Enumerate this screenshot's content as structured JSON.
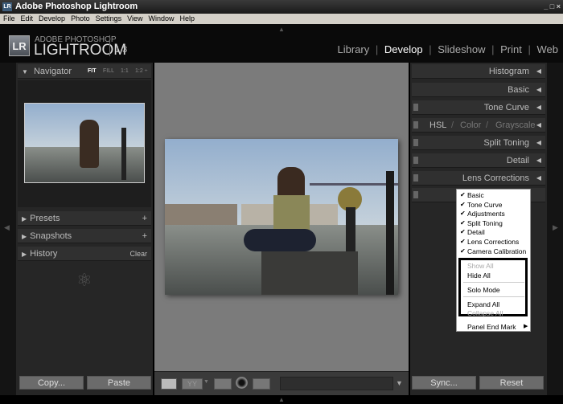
{
  "window": {
    "title": "Adobe Photoshop Lightroom",
    "app_icon": "LR",
    "controls": "_ □ ×"
  },
  "menubar": [
    "File",
    "Edit",
    "Develop",
    "Photo",
    "Settings",
    "View",
    "Window",
    "Help"
  ],
  "logo": {
    "badge": "LR",
    "line1": "ADOBE PHOTOSHOP",
    "line2": "LIGHTROOM",
    "version": "1.3"
  },
  "modules": [
    {
      "label": "Library"
    },
    {
      "label": "Develop",
      "active": true
    },
    {
      "label": "Slideshow"
    },
    {
      "label": "Print"
    },
    {
      "label": "Web"
    }
  ],
  "left_panel": {
    "navigator": {
      "title": "Navigator",
      "zoom_options": [
        "FIT",
        "FILL",
        "1:1",
        "1:2 ÷"
      ],
      "selected": "FIT"
    },
    "sections": [
      {
        "title": "Presets",
        "action": "+"
      },
      {
        "title": "Snapshots",
        "action": "+"
      },
      {
        "title": "History",
        "action": "Clear"
      }
    ],
    "copy_label": "Copy...",
    "paste_label": "Paste"
  },
  "right_panel": {
    "sections": [
      "Histogram",
      "Basic",
      "Tone Curve",
      "Split Toning",
      "Detail",
      "Lens Corrections"
    ],
    "hsl": {
      "items": [
        "HSL",
        "Color",
        "Grayscale"
      ],
      "separator": "/"
    },
    "sync_label": "Sync...",
    "reset_label": "Reset"
  },
  "context_menu": {
    "checked_items": [
      "Basic",
      "Tone Curve",
      "Adjustments",
      "Split Toning",
      "Detail",
      "Lens Corrections",
      "Camera Calibration"
    ],
    "show_all": "Show All",
    "hide_all": "Hide All",
    "solo_mode": "Solo Mode",
    "expand_all": "Expand All",
    "collapse_all": "Collapse All",
    "panel_end_mark": "Panel End Mark"
  },
  "colors": {
    "accent_bg": "#262626",
    "center_bg": "#7b7b7b"
  }
}
